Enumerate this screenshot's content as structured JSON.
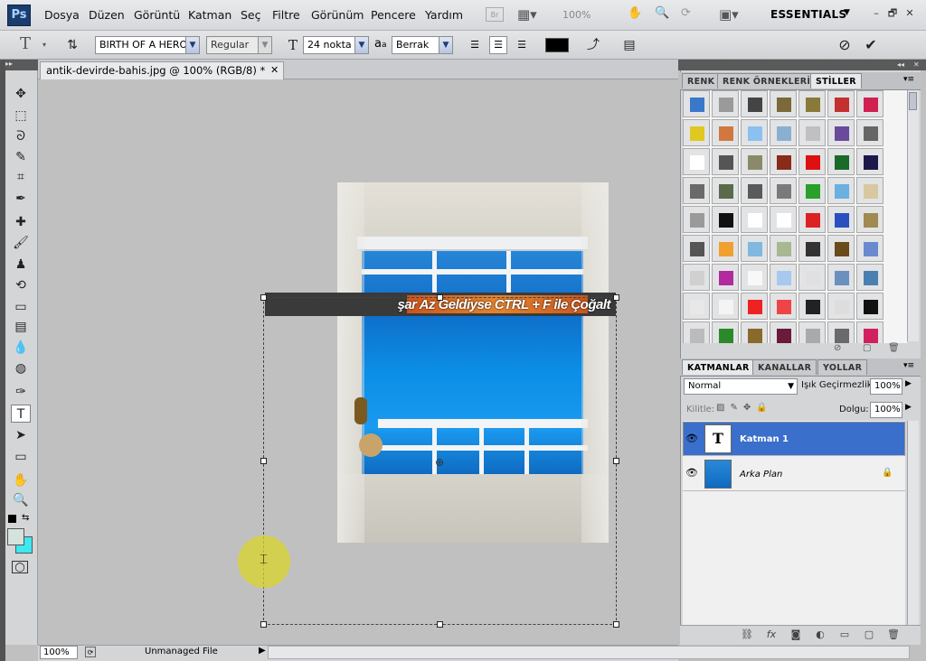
{
  "app": {
    "logo": "Ps",
    "menu": [
      "Dosya",
      "Düzen",
      "Görüntü",
      "Katman",
      "Seç",
      "Filtre",
      "Görünüm",
      "Pencere",
      "Yardım"
    ],
    "zoom_display": "100%",
    "workspace": "ESSENTIALS",
    "window_controls": [
      "–",
      "🗗",
      "✕"
    ]
  },
  "options": {
    "tool_glyph": "T",
    "font_family": "BIRTH OF A HERO",
    "font_style": "Regular",
    "font_size": "24 nokta",
    "aa_label": "a",
    "antialias": "Berrak",
    "text_color": "#000000"
  },
  "document": {
    "tab_title": "antik-devirde-bahis.jpg @ 100% (RGB/8) *",
    "close_glyph": "✕",
    "layer_text": "şar Az Geldiyse CTRL + F  ile Çoğalt"
  },
  "toolbar": {
    "tools": [
      {
        "name": "move-tool",
        "glyph": "✥"
      },
      {
        "name": "marquee-tool",
        "glyph": "⬚"
      },
      {
        "name": "lasso-tool",
        "glyph": "ᘐ"
      },
      {
        "name": "quick-select-tool",
        "glyph": "✎"
      },
      {
        "name": "crop-tool",
        "glyph": "⌗"
      },
      {
        "name": "eyedropper-tool",
        "glyph": "✒"
      },
      {
        "name": "healing-tool",
        "glyph": "✚"
      },
      {
        "name": "brush-tool",
        "glyph": "🖌"
      },
      {
        "name": "stamp-tool",
        "glyph": "♟"
      },
      {
        "name": "history-brush-tool",
        "glyph": "⟲"
      },
      {
        "name": "eraser-tool",
        "glyph": "▭"
      },
      {
        "name": "gradient-tool",
        "glyph": "▤"
      },
      {
        "name": "blur-tool",
        "glyph": "💧"
      },
      {
        "name": "dodge-tool",
        "glyph": "◍"
      },
      {
        "name": "pen-tool",
        "glyph": "✑"
      },
      {
        "name": "type-tool",
        "glyph": "T"
      },
      {
        "name": "path-select-tool",
        "glyph": "➤"
      },
      {
        "name": "shape-tool",
        "glyph": "▭"
      },
      {
        "name": "hand-tool",
        "glyph": "✋"
      },
      {
        "name": "zoom-tool",
        "glyph": "🔍"
      }
    ]
  },
  "status": {
    "zoom": "100%",
    "profile": "Unmanaged File"
  },
  "styles_panel": {
    "tabs": [
      "RENK",
      "RENK ÖRNEKLERİ",
      "STİLLER"
    ],
    "swatches": [
      "#3b78c9",
      "#9a9a9a",
      "#444444",
      "#7a6a3a",
      "#8a7a3a",
      "#c43030",
      "#d02050",
      "#e0c820",
      "#d07840",
      "#8cc0f0",
      "#8ab0d0",
      "#c0c0c0",
      "#6a4a9a",
      "#666666",
      "#ffffff",
      "#555555",
      "#8a8a6a",
      "#8a2a1a",
      "#dd1111",
      "#1a6a2a",
      "#1a1a4a",
      "#6a6a6a",
      "#5a6a4a",
      "#5a5a5a",
      "#7a7a7a",
      "#2aa02a",
      "#6ab0e0",
      "#d8c8a0",
      "#9a9a9a",
      "#111111",
      "#ffffff",
      "#ffffff",
      "#dd2222",
      "#2a50c0",
      "#a08a50",
      "#555555",
      "#f0a030",
      "#80b8e0",
      "#a8b890",
      "#333333",
      "#6a4a1a",
      "#6a8ad0",
      "#d0d0d0",
      "#b02aa0",
      "#f8f8f8",
      "#a8c8f0",
      "#e0e0e0",
      "#6a90c0",
      "#4a80b0",
      "#e8e8e8",
      "#f4f4f4",
      "#ee2222",
      "#ee4444",
      "#222222",
      "#dddddd",
      "#111111",
      "#bbbbbb",
      "#2a8a2a",
      "#8a6a2a",
      "#6a1a3a",
      "#aaaaaa",
      "#6a6a6a",
      "#d02060"
    ]
  },
  "layers_panel": {
    "tabs": [
      "KATMANLAR",
      "KANALLAR",
      "YOLLAR"
    ],
    "blend_mode": "Normal",
    "opacity_label": "Işık Geçirmezlik:",
    "opacity": "100%",
    "lock_label": "Kilitle:",
    "fill_label": "Dolgu:",
    "fill": "100%",
    "layers": [
      {
        "name": "Katman 1",
        "thumb": "T",
        "selected": true
      },
      {
        "name": "Arka Plan",
        "thumb": "",
        "selected": false
      }
    ]
  }
}
